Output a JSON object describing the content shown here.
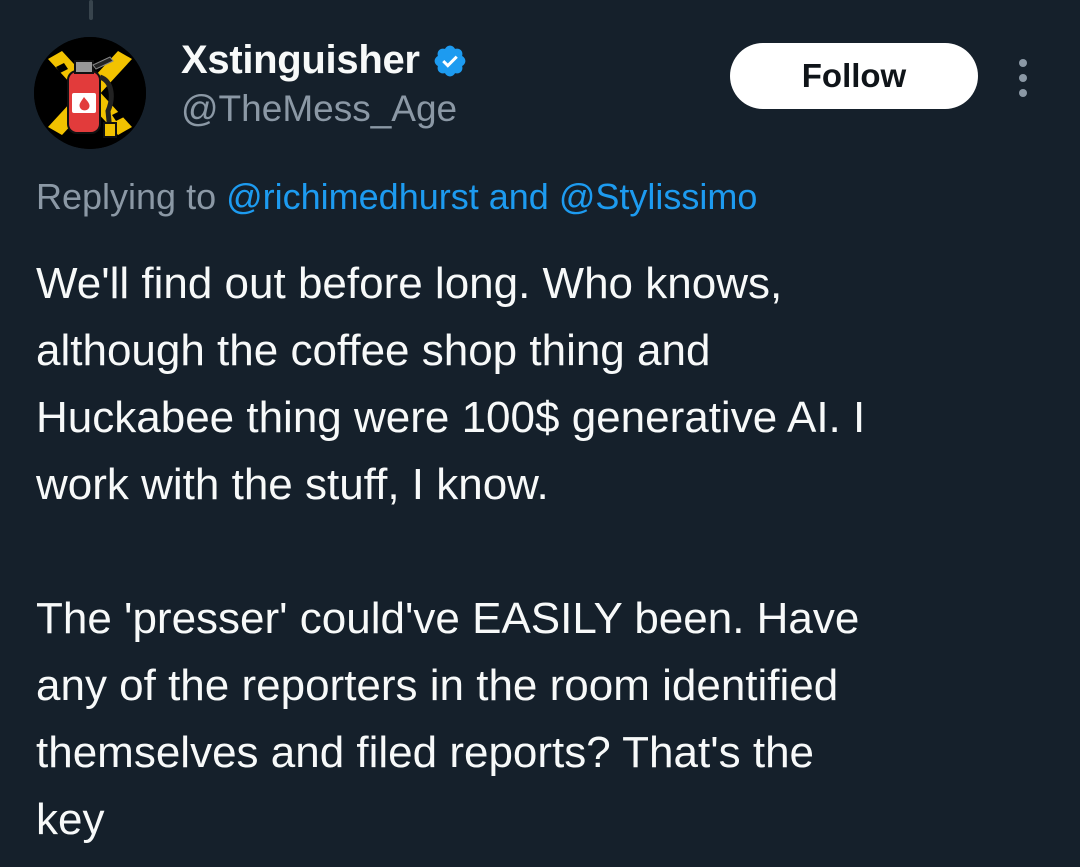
{
  "tweet": {
    "author": {
      "display_name": "Xstinguisher",
      "handle": "@TheMess_Age",
      "verified": true,
      "avatar_icon": "fire-extinguisher-icon",
      "verified_icon": "verified-badge-icon"
    },
    "follow_label": "Follow",
    "more_icon": "more-vertical-icon",
    "replying_to": {
      "prefix": "Replying to",
      "mention_1": "@richimedhurst",
      "connector": "and",
      "mention_2": "@Stylissimo"
    },
    "body_lines": [
      "We'll find out before long. Who knows,",
      "although the coffee shop thing and",
      "Huckabee thing were 100$ generative AI. I",
      "work with the stuff, I know.",
      "The 'presser' could've EASILY been. Have",
      "any of the reporters in the room identified",
      "themselves and filed reports? That's the",
      "key"
    ]
  },
  "colors": {
    "background": "#15202b",
    "text_primary": "#f7f9f9",
    "text_secondary": "#8b98a5",
    "link": "#1d9bf0",
    "verified": "#1d9bf0",
    "follow_bg": "#ffffff"
  }
}
